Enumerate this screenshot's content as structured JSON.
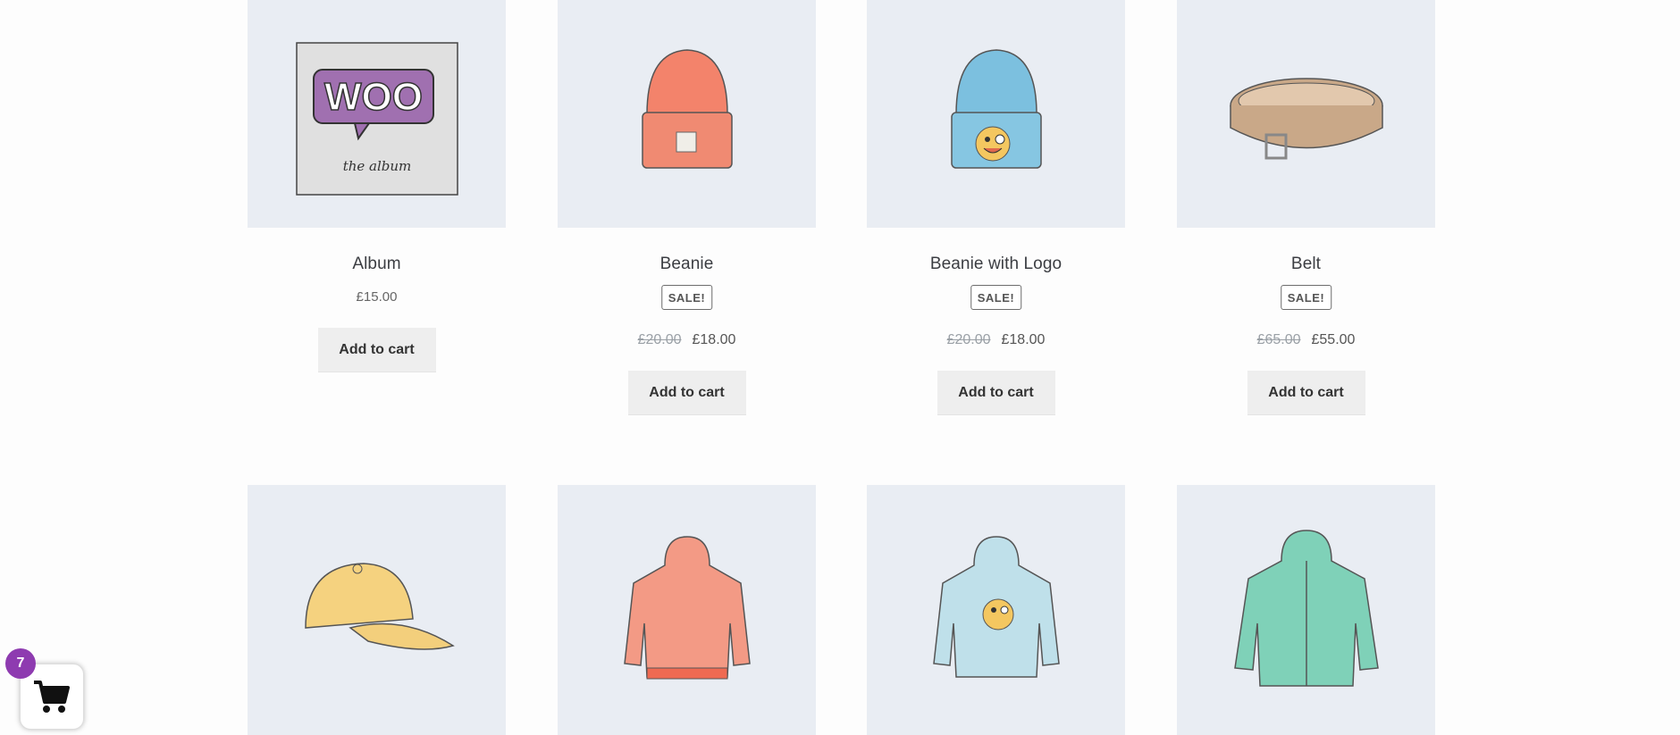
{
  "products_row1": [
    {
      "name": "Album",
      "price": "£15.00",
      "on_sale": false,
      "button": "Add to cart",
      "icon": "woo-album-icon"
    },
    {
      "name": "Beanie",
      "sale_badge": "SALE!",
      "old_price": "£20.00",
      "price": "£18.00",
      "on_sale": true,
      "button": "Add to cart",
      "icon": "beanie-icon"
    },
    {
      "name": "Beanie with Logo",
      "sale_badge": "SALE!",
      "old_price": "£20.00",
      "price": "£18.00",
      "on_sale": true,
      "button": "Add to cart",
      "icon": "beanie-logo-icon"
    },
    {
      "name": "Belt",
      "sale_badge": "SALE!",
      "old_price": "£65.00",
      "price": "£55.00",
      "on_sale": true,
      "button": "Add to cart",
      "icon": "belt-icon"
    }
  ],
  "products_row2": [
    {
      "icon": "cap-icon"
    },
    {
      "icon": "hoodie-icon"
    },
    {
      "icon": "hoodie-logo-icon"
    },
    {
      "icon": "zip-hoodie-icon"
    }
  ],
  "cart": {
    "count": "7",
    "icon": "cart-icon"
  },
  "album_art": {
    "logo_text": "WOO",
    "caption": "the album"
  },
  "colors": {
    "accent": "#8e3bb0",
    "thumb_bg": "#e9edf3",
    "button_bg": "#eeeeee"
  }
}
